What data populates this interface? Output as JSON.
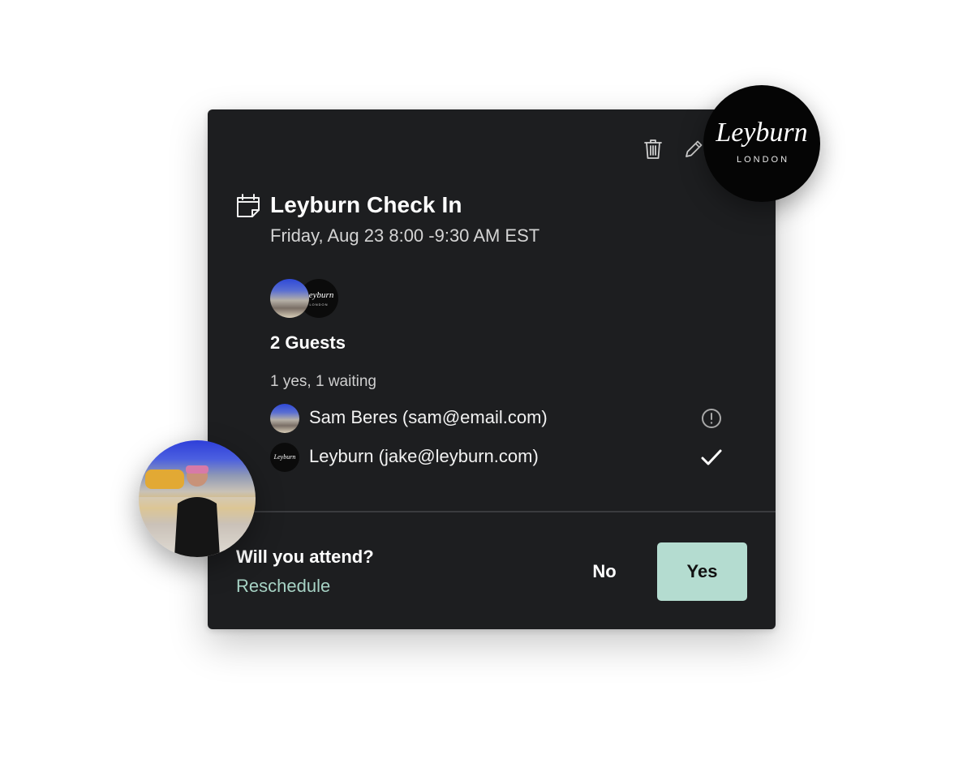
{
  "brand": {
    "name": "Leyburn",
    "subtitle": "LONDON"
  },
  "event": {
    "title": "Leyburn Check In",
    "datetime": "Friday, Aug 23 8:00 -9:30 AM EST"
  },
  "guests": {
    "heading": "2 Guests",
    "summary": "1 yes, 1 waiting",
    "list": [
      {
        "name": "Sam Beres (sam@email.com)",
        "status": "waiting",
        "status_icon": "exclamation-circle-icon"
      },
      {
        "name": "Leyburn (jake@leyburn.com)",
        "status": "yes",
        "status_icon": "check-icon"
      }
    ]
  },
  "rsvp": {
    "question": "Will you attend?",
    "reschedule": "Reschedule",
    "no_label": "No",
    "yes_label": "Yes"
  },
  "colors": {
    "card_bg": "#1d1e20",
    "accent": "#b4dcd0",
    "link": "#a6d2c4"
  }
}
